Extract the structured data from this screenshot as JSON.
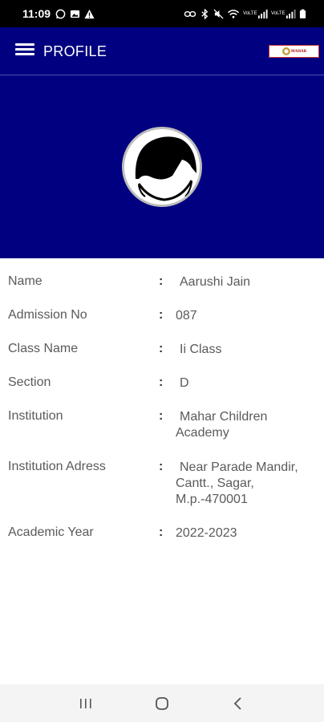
{
  "status_bar": {
    "time": "11:09",
    "icons_left": [
      "whatsapp-icon",
      "image-icon",
      "warning-icon"
    ],
    "icons_right": [
      "link-icon",
      "bluetooth-icon",
      "mute-icon",
      "wifi-icon",
      "signal-icon",
      "signal-icon",
      "battery-icon"
    ],
    "network_label_1": "VoLTE",
    "network_label_2": "VoLTE"
  },
  "app_bar": {
    "title": "PROFILE",
    "logo_text": "MAHAR"
  },
  "profile": {
    "rows": [
      {
        "label": "Name",
        "value": "Aarushi Jain"
      },
      {
        "label": "Admission No",
        "value": "087"
      },
      {
        "label": "Class Name",
        "value": "Ii Class"
      },
      {
        "label": "Section",
        "value": "D"
      },
      {
        "label": "Institution",
        "value": "Mahar Children Academy"
      },
      {
        "label": "Institution Adress",
        "value": "Near Parade Mandir, Cantt., Sagar, M.p.-470001"
      },
      {
        "label": "Academic Year",
        "value": "2022-2023"
      }
    ],
    "separator": ":"
  }
}
